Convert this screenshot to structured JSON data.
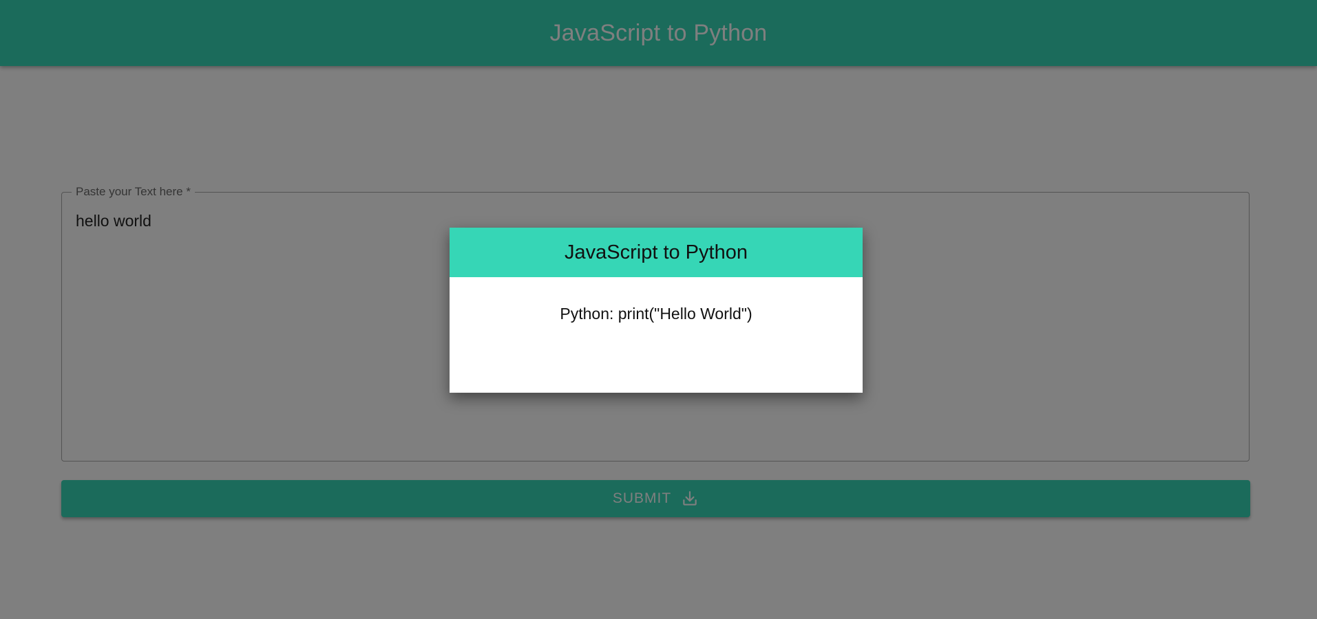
{
  "header": {
    "title": "JavaScript to Python"
  },
  "input": {
    "label": "Paste your Text here *",
    "value": "hello world"
  },
  "submit": {
    "label": "SUBMIT",
    "icon": "download-icon"
  },
  "dialog": {
    "title": "JavaScript to Python",
    "result": "Python: print(\"Hello World\")"
  },
  "colors": {
    "accent": "#36d6b6",
    "overlay": "rgba(0,0,0,0.5)"
  }
}
